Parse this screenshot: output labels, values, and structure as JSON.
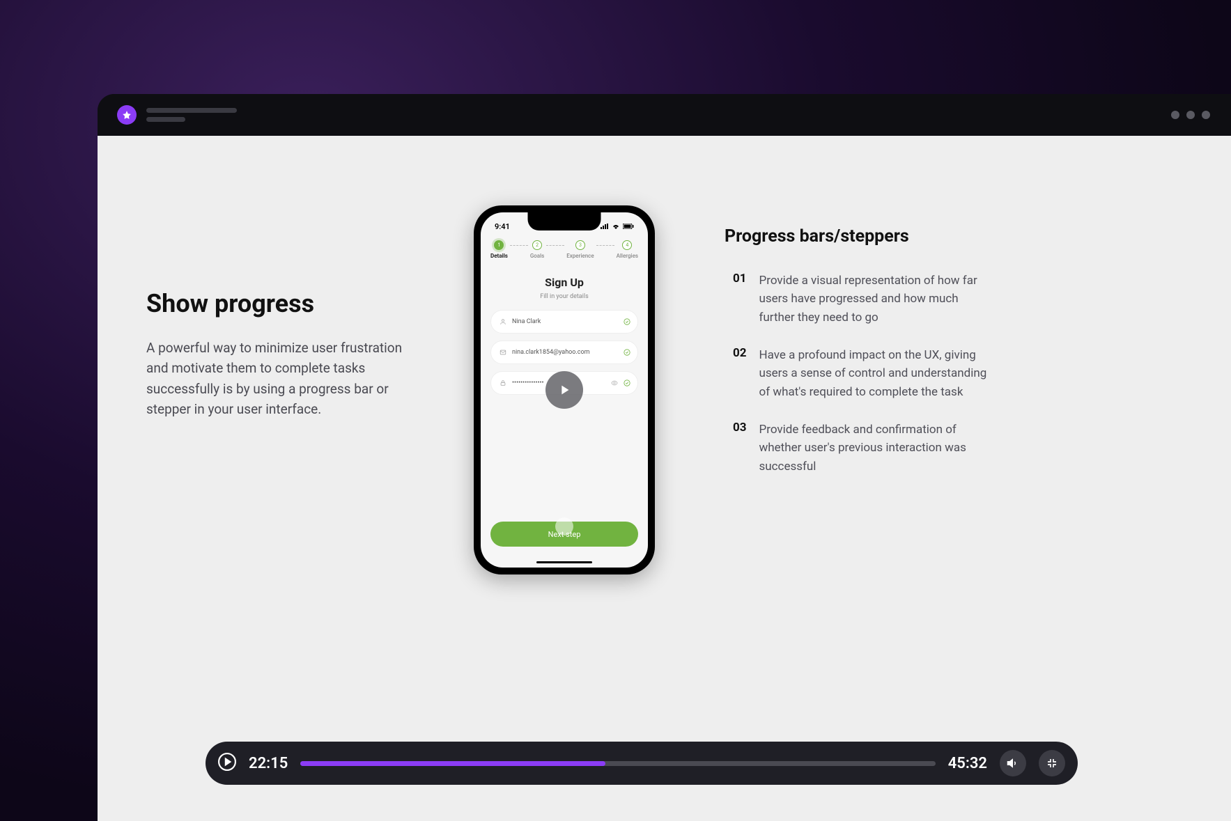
{
  "left": {
    "title": "Show progress",
    "description": "A powerful way to minimize user frustration and motivate them to complete tasks successfully is by using a progress bar or stepper in your user interface."
  },
  "phone": {
    "time": "9:41",
    "steps": [
      {
        "num": "1",
        "label": "Details"
      },
      {
        "num": "2",
        "label": "Goals"
      },
      {
        "num": "3",
        "label": "Experience"
      },
      {
        "num": "4",
        "label": "Allergies"
      }
    ],
    "signup_title": "Sign Up",
    "signup_subtitle": "Fill in your details",
    "name_value": "Nina Clark",
    "email_value": "nina.clark1854@yahoo.com",
    "password_value": "•••••••••••••••",
    "next_label": "Next step"
  },
  "right": {
    "title": "Progress bars/steppers",
    "points": [
      {
        "num": "01",
        "text": "Provide a visual representation of how far users have progressed and how much further they need to go"
      },
      {
        "num": "02",
        "text": "Have a profound impact on the UX, giving users a sense of control and understanding of what's required to complete the task"
      },
      {
        "num": "03",
        "text": "Provide feedback and confirmation of whether user's previous interaction was successful"
      }
    ]
  },
  "video": {
    "current_time": "22:15",
    "total_time": "45:32",
    "progress_percent": 48
  }
}
